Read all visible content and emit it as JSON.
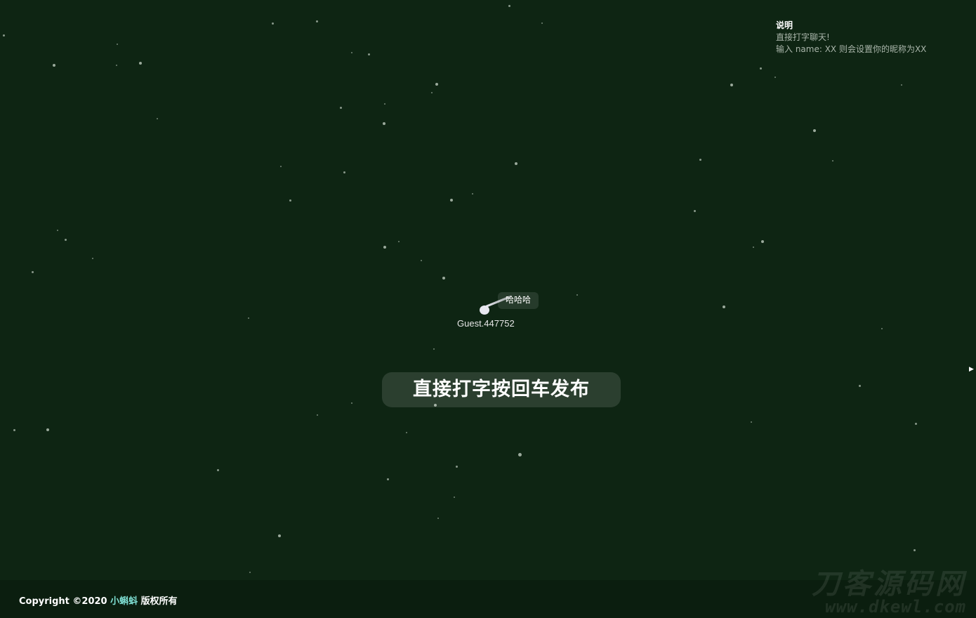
{
  "help": {
    "title": "说明",
    "lines": [
      "直接打字聊天!",
      "输入 name: XX 则会设置你的昵称为XX"
    ]
  },
  "player": {
    "name": "Guest.447752",
    "message": "哈哈哈"
  },
  "hint": "直接打字按回车发布",
  "footer": {
    "copyright_prefix": "Copyright ©2020 ",
    "copyright_name": "小蝌蚪",
    "copyright_suffix": " 版权所有"
  },
  "watermark": {
    "text_cn": "刀客源码网",
    "text_url": "www.dkewl.com"
  },
  "colors": {
    "background": "#0e2513",
    "footer_background": "#0b1e0f",
    "accent_name": "#7fe0d4"
  },
  "icons": {
    "right_edge": "triangle-right-icon"
  }
}
